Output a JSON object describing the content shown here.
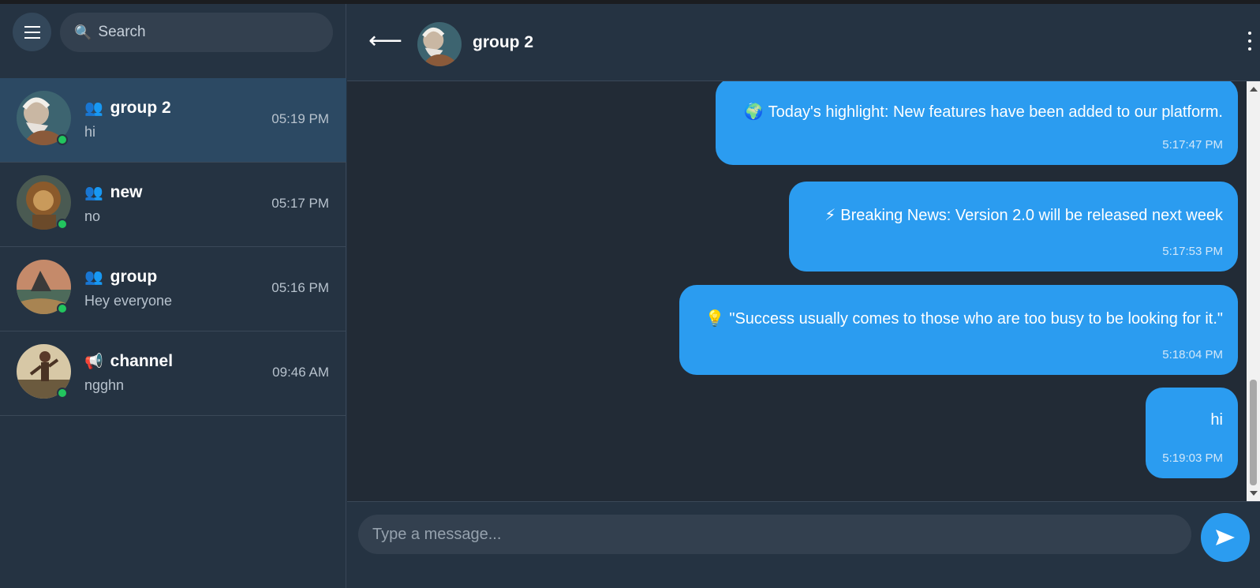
{
  "sidebar": {
    "search_placeholder": "Search",
    "chats": [
      {
        "name": "group 2",
        "kind_icon": "group-icon",
        "last_message": "hi",
        "time": "05:19 PM",
        "active": true,
        "online": true
      },
      {
        "name": "new",
        "kind_icon": "group-icon",
        "last_message": "no",
        "time": "05:17 PM",
        "active": false,
        "online": true
      },
      {
        "name": "group",
        "kind_icon": "group-icon",
        "last_message": "Hey everyone",
        "time": "05:16 PM",
        "active": false,
        "online": true
      },
      {
        "name": "channel",
        "kind_icon": "megaphone-icon",
        "last_message": "ngghn",
        "time": "09:46 AM",
        "active": false,
        "online": true
      }
    ]
  },
  "header": {
    "title": "group 2"
  },
  "messages": [
    {
      "emoji": "🌍",
      "text": "Today's highlight: New features have been added to our platform.",
      "time": "5:17:47 PM"
    },
    {
      "emoji": "⚡",
      "text": "Breaking News: Version 2.0 will be released next week",
      "time": "5:17:53 PM"
    },
    {
      "emoji": "💡",
      "text": "\"Success usually comes to those who are too busy to be looking for it.\"",
      "time": "5:18:04 PM"
    },
    {
      "emoji": "",
      "text": "hi",
      "time": "5:19:03 PM"
    }
  ],
  "composer": {
    "placeholder": "Type a message..."
  },
  "colors": {
    "accent": "#2b9cf0",
    "online": "#22c55e",
    "active_chat": "#2c4963"
  }
}
